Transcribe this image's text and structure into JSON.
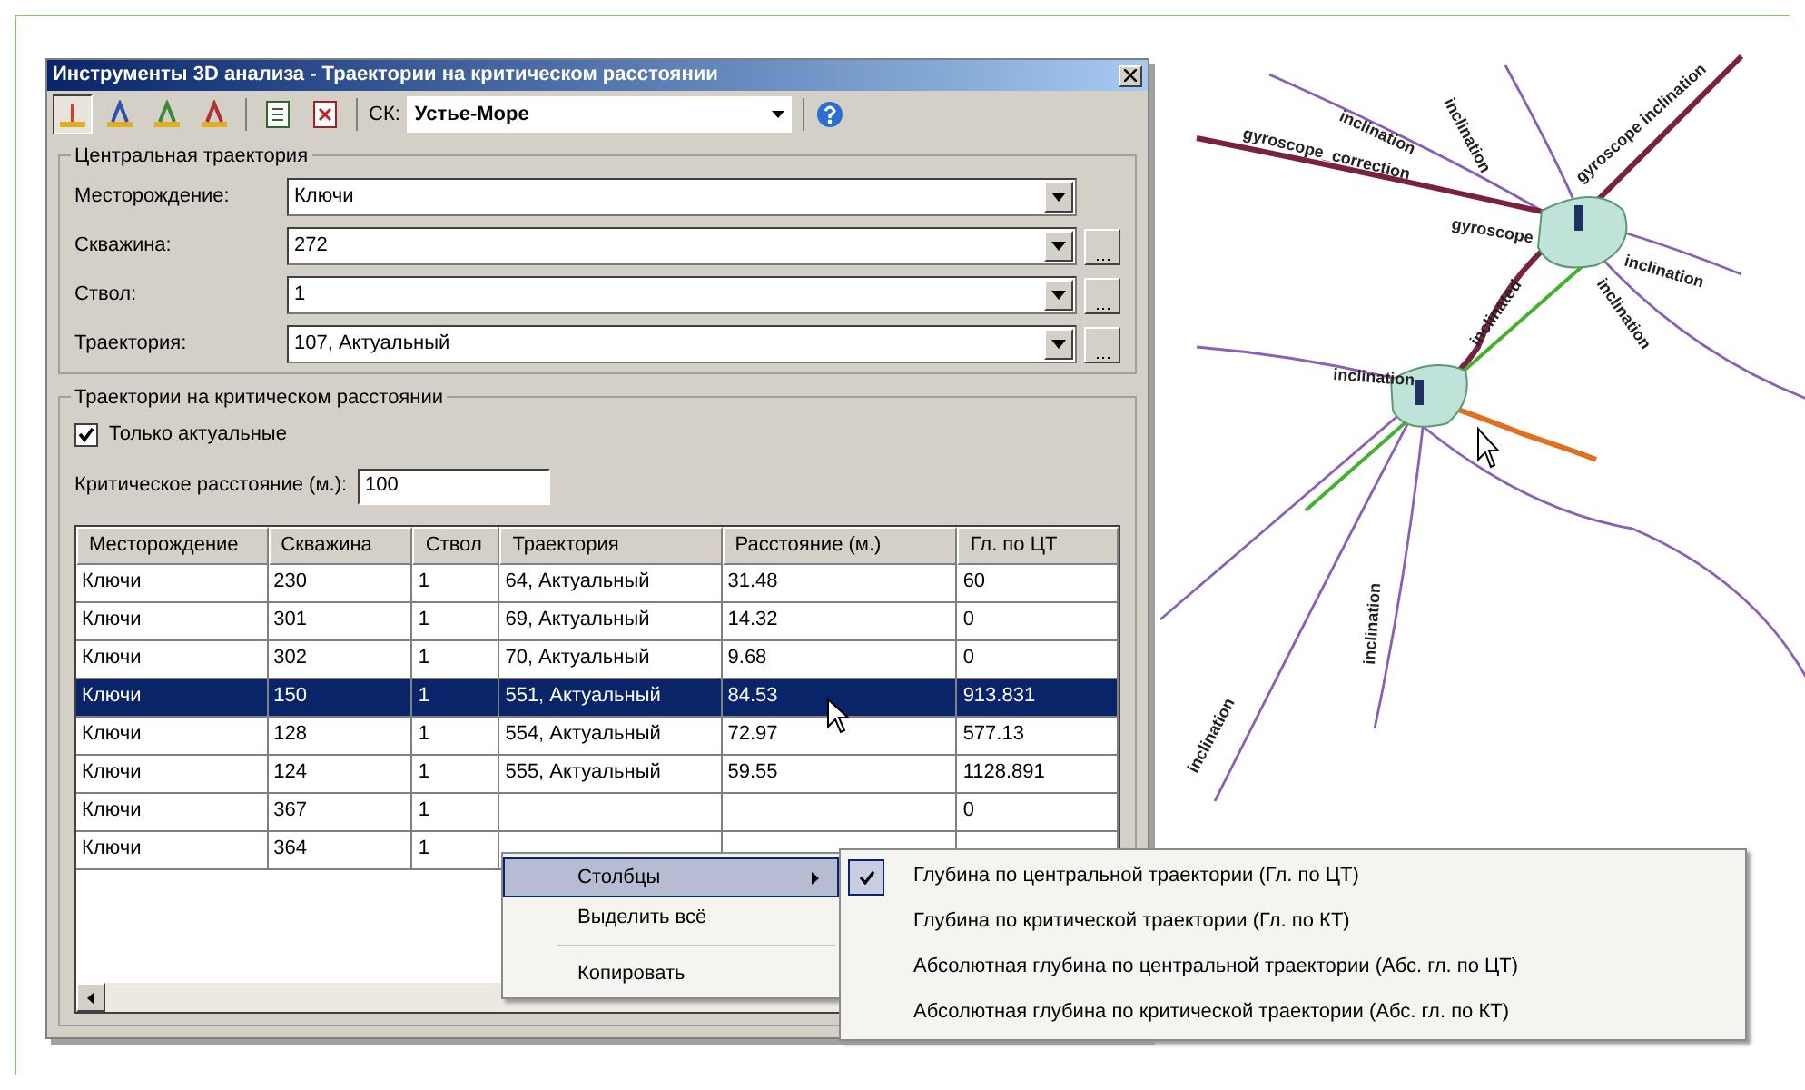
{
  "dialog": {
    "title": "Инструменты 3D анализа - Траектории на критическом расстоянии"
  },
  "toolbar": {
    "tools": [
      {
        "selected": true
      },
      {
        "selected": false
      },
      {
        "selected": false
      },
      {
        "selected": false
      }
    ],
    "ck_label": "СК:",
    "ck_value": "Устье-Море"
  },
  "central": {
    "legend": "Центральная траектория",
    "fields": [
      {
        "label": "Месторождение:",
        "value": "Ключи",
        "browse": false
      },
      {
        "label": "Скважина:",
        "value": "272",
        "browse": true
      },
      {
        "label": "Ствол:",
        "value": "1",
        "browse": true
      },
      {
        "label": "Траектория:",
        "value": "107, Актуальный",
        "browse": true
      }
    ]
  },
  "critical": {
    "legend": "Траектории на критическом расстоянии",
    "only_actual": {
      "label": "Только актуальные",
      "checked": true
    },
    "distance": {
      "label": "Критическое расстояние (м.):",
      "value": "100"
    },
    "table": {
      "columns": [
        "Месторождение",
        "Скважина",
        "Ствол",
        "Траектория",
        "Расстояние (м.)",
        "Гл. по ЦТ"
      ],
      "rows": [
        {
          "cells": [
            "Ключи",
            "230",
            "1",
            "64, Актуальный",
            "31.48",
            "60"
          ],
          "selected": false
        },
        {
          "cells": [
            "Ключи",
            "301",
            "1",
            "69, Актуальный",
            "14.32",
            "0"
          ],
          "selected": false
        },
        {
          "cells": [
            "Ключи",
            "302",
            "1",
            "70, Актуальный",
            "9.68",
            "0"
          ],
          "selected": false
        },
        {
          "cells": [
            "Ключи",
            "150",
            "1",
            "551, Актуальный",
            "84.53",
            "913.831"
          ],
          "selected": true
        },
        {
          "cells": [
            "Ключи",
            "128",
            "1",
            "554, Актуальный",
            "72.97",
            "577.13"
          ],
          "selected": false
        },
        {
          "cells": [
            "Ключи",
            "124",
            "1",
            "555, Актуальный",
            "59.55",
            "1128.891"
          ],
          "selected": false
        },
        {
          "cells": [
            "Ключи",
            "367",
            "1",
            null,
            null,
            "0"
          ],
          "selected": false
        },
        {
          "cells": [
            "Ключи",
            "364",
            "1",
            null,
            null,
            null
          ],
          "selected": false
        }
      ]
    }
  },
  "context_menu": {
    "items": [
      {
        "kind": "submenu",
        "label": "Столбцы",
        "selected": true
      },
      {
        "kind": "item",
        "label": "Выделить всё",
        "selected": false
      },
      {
        "kind": "separator"
      },
      {
        "kind": "item",
        "label": "Копировать",
        "selected": false
      }
    ]
  },
  "submenu": {
    "items": [
      {
        "label": "Глубина по центральной траектории (Гл. по ЦТ)",
        "checked": true
      },
      {
        "label": "Глубина по критической траектории (Гл. по КТ)",
        "checked": false
      },
      {
        "label": "Абсолютная глубина по центральной траектории (Абс. гл. по ЦТ)",
        "checked": false
      },
      {
        "label": "Абсолютная глубина по критической траектории (Абс. гл. по КТ)",
        "checked": false
      }
    ]
  },
  "viewport": {
    "labels": [
      "inclination",
      "inclination",
      "gyroscope_correction",
      "gyroscope",
      "gyroscope inclination",
      "inclination",
      "inclination",
      "inclinated",
      "inclination",
      "inclination",
      "inclination"
    ]
  }
}
